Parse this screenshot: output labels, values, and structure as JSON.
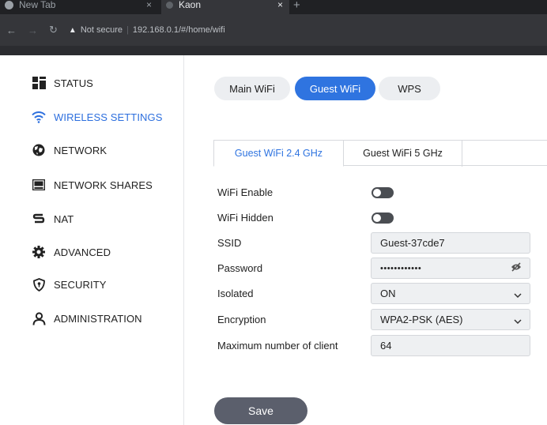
{
  "browser": {
    "tab1_title": "New Tab",
    "tab2_title": "Kaon",
    "close_glyph": "×",
    "new_tab_glyph": "+",
    "not_secure": "Not secure",
    "url_separator": "|",
    "url": "192.168.0.1/#/home/wifi"
  },
  "sidebar": {
    "items": [
      {
        "label": "STATUS",
        "icon": "status-icon"
      },
      {
        "label": "WIRELESS SETTINGS",
        "icon": "wifi-icon",
        "active": true
      },
      {
        "label": "NETWORK",
        "icon": "network-globe-icon"
      },
      {
        "label": "NETWORK SHARES",
        "icon": "network-shares-icon"
      },
      {
        "label": "NAT",
        "icon": "nat-icon"
      },
      {
        "label": "ADVANCED",
        "icon": "gear-icon"
      },
      {
        "label": "SECURITY",
        "icon": "shield-icon"
      },
      {
        "label": "ADMINISTRATION",
        "icon": "user-icon"
      }
    ]
  },
  "top_tabs": [
    "Main WiFi",
    "Guest WiFi",
    "WPS"
  ],
  "top_tabs_active": "Guest WiFi",
  "band_tabs": [
    "Guest WiFi 2.4 GHz",
    "Guest WiFi 5 GHz"
  ],
  "band_tabs_active": "Guest WiFi 2.4 GHz",
  "form": {
    "wifi_enable_label": "WiFi Enable",
    "wifi_enable": false,
    "wifi_hidden_label": "WiFi Hidden",
    "wifi_hidden": false,
    "ssid_label": "SSID",
    "ssid_value": "Guest-37cde7",
    "password_label": "Password",
    "password_value": "••••••••••••",
    "isolated_label": "Isolated",
    "isolated_value": "ON",
    "encryption_label": "Encryption",
    "encryption_value": "WPA2-PSK (AES)",
    "max_clients_label": "Maximum number of client",
    "max_clients_value": "64"
  },
  "save_label": "Save",
  "colors": {
    "accent": "#2f74e0",
    "save_button": "#5b5f6c",
    "toggle_off": "#4a4d52"
  }
}
